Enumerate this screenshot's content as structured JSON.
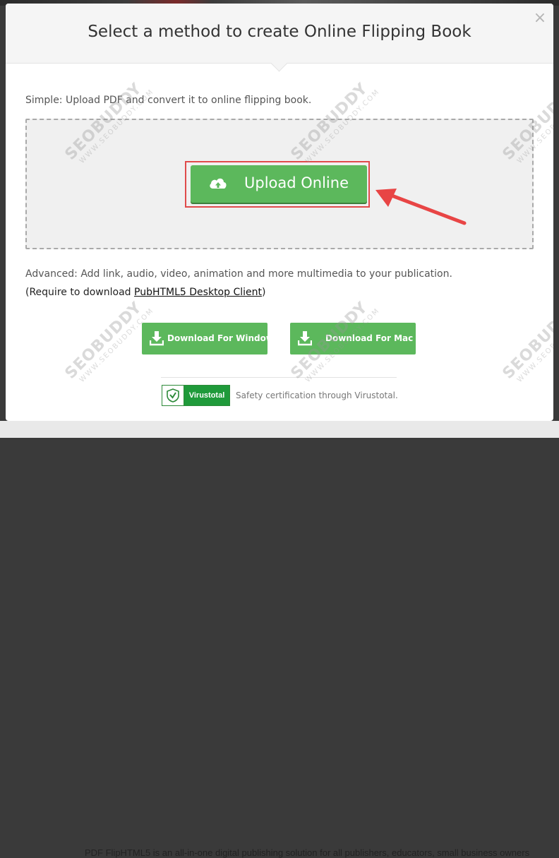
{
  "modal": {
    "title": "Select a method to create Online Flipping Book",
    "close_symbol": "×"
  },
  "simple": {
    "description": "Simple: Upload PDF and convert it to online flipping book.",
    "upload_label": "Upload Online",
    "upload_icon": "cloud-upload-icon"
  },
  "advanced": {
    "description": "Advanced: Add link, audio, video, animation and more multimedia to your publication.",
    "require_prefix": "(Require to download ",
    "require_link": "PubHTML5 Desktop Client",
    "require_suffix": ")",
    "windows_label": "Download For Windows",
    "mac_label": "Download For Mac"
  },
  "virustotal": {
    "badge": "Virustotal",
    "text": "Safety certification through Virustotal."
  },
  "background": {
    "bottom_text": "PDF FlipHTML5 is an all-in-one digital publishing solution for all publishers, educators, small business owners"
  },
  "watermark": {
    "brand": "SEOBUDDY",
    "url": "WWW.SEOBUDDY.COM"
  },
  "colors": {
    "accent_green": "#5cb85c",
    "highlight_red": "#e04b4b",
    "virustotal_green": "#1f9a3a"
  }
}
